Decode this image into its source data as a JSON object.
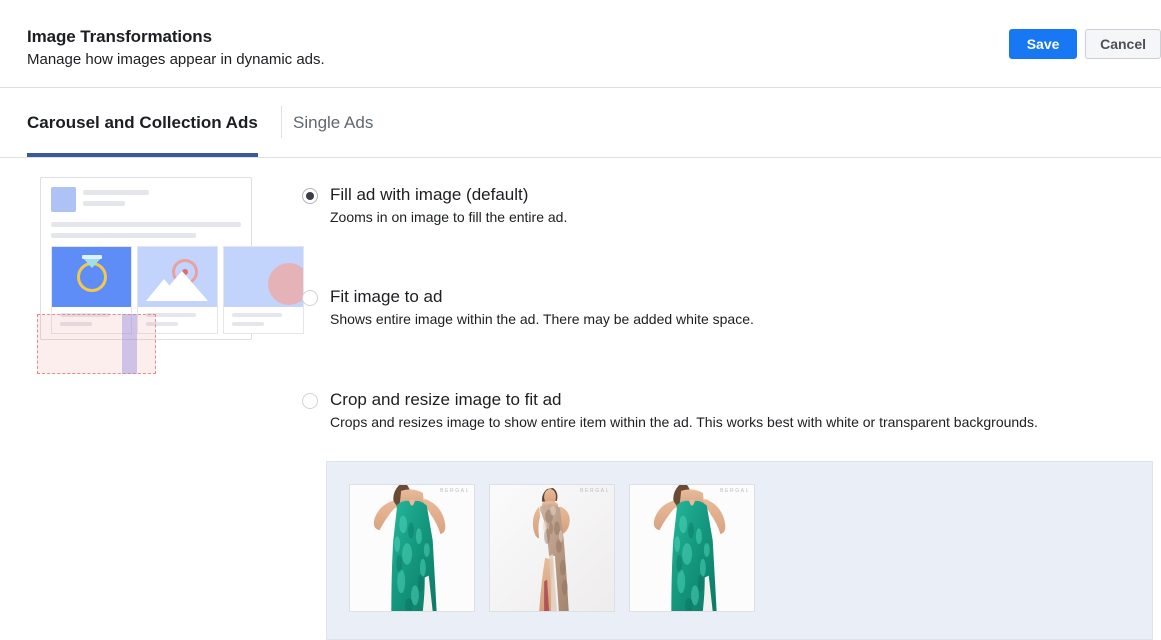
{
  "header": {
    "title": "Image Transformations",
    "subtitle": "Manage how images appear in dynamic ads.",
    "save_label": "Save",
    "cancel_label": "Cancel"
  },
  "tabs": [
    {
      "label": "Carousel and Collection Ads",
      "active": true
    },
    {
      "label": "Single Ads",
      "active": false
    }
  ],
  "options": [
    {
      "label": "Fill ad with image (default)",
      "description": "Zooms in on image to fill the entire ad.",
      "selected": true
    },
    {
      "label": "Fit image to ad",
      "description": "Shows entire image within the ad. There may be added white space.",
      "selected": false
    },
    {
      "label": "Crop and resize image to fit ad",
      "description": "Crops and resizes image to show entire item within the ad. This works best with white or transparent backgrounds.",
      "selected": false
    }
  ],
  "preview": {
    "name": "carousel-ad-preview",
    "tiles": [
      "ring-icon",
      "image-icon",
      "circle-icon"
    ]
  },
  "image_panel": {
    "thumbnails": [
      {
        "name": "dress-teal-cropped",
        "watermark": "BERGAL"
      },
      {
        "name": "dress-nude-full",
        "watermark": "BERGAL"
      },
      {
        "name": "dress-teal-cropped-2",
        "watermark": "BERGAL"
      }
    ]
  },
  "colors": {
    "primary_blue": "#1877f2",
    "tab_underline": "#3b5998",
    "panel_bg": "#eaeff7",
    "dress_teal": "#19a08c"
  }
}
